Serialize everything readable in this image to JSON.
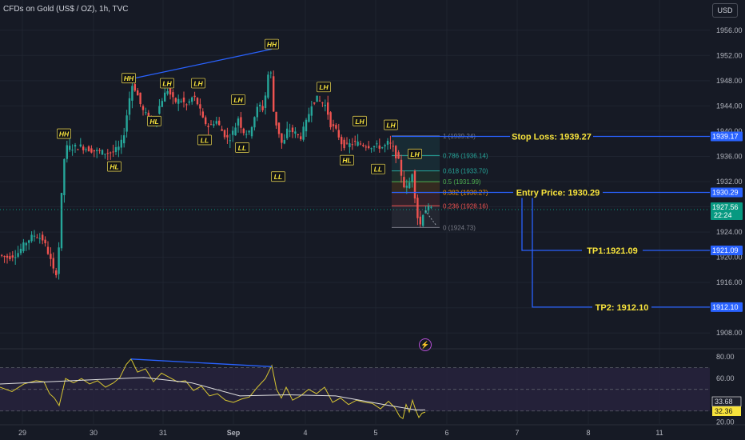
{
  "header": {
    "title": "CFDs on Gold (US$ / OZ), 1h, TVC",
    "currency": "USD"
  },
  "colors": {
    "background": "#161a25",
    "grid": "#1f2430",
    "axis_text": "#b2b5be",
    "up": "#26a69a",
    "down": "#ef5350",
    "trade_line": "#2962ff",
    "annotation_text": "#f7e33c",
    "rsi": "#d7c631",
    "rsi_ma": "#e0e0e0",
    "rsi_band": "#2a2440",
    "current_price_bg": "#089981"
  },
  "icons": [
    "lightning-icon"
  ],
  "chart_data": [
    {
      "type": "candlestick",
      "title": "CFDs on Gold (US$ / OZ), 1h, TVC",
      "ylim": [
        1906,
        1958
      ],
      "y_ticks": [
        1956,
        1952,
        1948,
        1944,
        1940,
        1936,
        1932,
        1928,
        1924,
        1920,
        1916,
        1912,
        1908
      ],
      "x_ticks": [
        "29",
        "30",
        "31",
        "Sep",
        "4",
        "5",
        "6",
        "7",
        "8",
        "11"
      ],
      "price_path": [
        {
          "x": 0,
          "y": 1920.4
        },
        {
          "x": 12,
          "y": 1920.0
        },
        {
          "x": 24,
          "y": 1920.6
        },
        {
          "x": 36,
          "y": 1922.6
        },
        {
          "x": 46,
          "y": 1923.6
        },
        {
          "x": 56,
          "y": 1922.8
        },
        {
          "x": 64,
          "y": 1920.2
        },
        {
          "x": 70,
          "y": 1917.4
        },
        {
          "x": 74,
          "y": 1917.8
        },
        {
          "x": 78,
          "y": 1926.4
        },
        {
          "x": 81,
          "y": 1934.8
        },
        {
          "x": 86,
          "y": 1937.4
        },
        {
          "x": 94,
          "y": 1937.4
        },
        {
          "x": 102,
          "y": 1937.6
        },
        {
          "x": 112,
          "y": 1937.2
        },
        {
          "x": 122,
          "y": 1936.8
        },
        {
          "x": 132,
          "y": 1936.6
        },
        {
          "x": 142,
          "y": 1936.6
        },
        {
          "x": 150,
          "y": 1937.2
        },
        {
          "x": 156,
          "y": 1938.6
        },
        {
          "x": 162,
          "y": 1943.6
        },
        {
          "x": 167,
          "y": 1947.4
        },
        {
          "x": 172,
          "y": 1946.6
        },
        {
          "x": 180,
          "y": 1943.4
        },
        {
          "x": 188,
          "y": 1942.0
        },
        {
          "x": 194,
          "y": 1941.4
        },
        {
          "x": 200,
          "y": 1943.4
        },
        {
          "x": 206,
          "y": 1945.4
        },
        {
          "x": 212,
          "y": 1946.6
        },
        {
          "x": 220,
          "y": 1944.6
        },
        {
          "x": 228,
          "y": 1945.0
        },
        {
          "x": 236,
          "y": 1944.0
        },
        {
          "x": 244,
          "y": 1945.6
        },
        {
          "x": 250,
          "y": 1944.2
        },
        {
          "x": 256,
          "y": 1941.8
        },
        {
          "x": 264,
          "y": 1940.6
        },
        {
          "x": 272,
          "y": 1941.8
        },
        {
          "x": 280,
          "y": 1940.0
        },
        {
          "x": 288,
          "y": 1938.6
        },
        {
          "x": 296,
          "y": 1940.4
        },
        {
          "x": 300,
          "y": 1942.2
        },
        {
          "x": 306,
          "y": 1940.0
        },
        {
          "x": 314,
          "y": 1939.6
        },
        {
          "x": 320,
          "y": 1942.2
        },
        {
          "x": 326,
          "y": 1944.2
        },
        {
          "x": 332,
          "y": 1943.4
        },
        {
          "x": 336,
          "y": 1947.6
        },
        {
          "x": 340,
          "y": 1951.0
        },
        {
          "x": 344,
          "y": 1943.4
        },
        {
          "x": 348,
          "y": 1941.0
        },
        {
          "x": 352,
          "y": 1939.4
        },
        {
          "x": 356,
          "y": 1937.4
        },
        {
          "x": 362,
          "y": 1940.4
        },
        {
          "x": 370,
          "y": 1939.8
        },
        {
          "x": 378,
          "y": 1939.0
        },
        {
          "x": 386,
          "y": 1941.6
        },
        {
          "x": 392,
          "y": 1944.4
        },
        {
          "x": 398,
          "y": 1945.2
        },
        {
          "x": 404,
          "y": 1944.6
        },
        {
          "x": 410,
          "y": 1944.0
        },
        {
          "x": 416,
          "y": 1941.0
        },
        {
          "x": 424,
          "y": 1939.8
        },
        {
          "x": 430,
          "y": 1938.0
        },
        {
          "x": 436,
          "y": 1937.6
        },
        {
          "x": 444,
          "y": 1938.2
        },
        {
          "x": 452,
          "y": 1938.0
        },
        {
          "x": 460,
          "y": 1937.8
        },
        {
          "x": 468,
          "y": 1937.6
        },
        {
          "x": 476,
          "y": 1937.6
        },
        {
          "x": 482,
          "y": 1937.4
        },
        {
          "x": 488,
          "y": 1938.2
        },
        {
          "x": 494,
          "y": 1937.2
        },
        {
          "x": 498,
          "y": 1936.0
        },
        {
          "x": 502,
          "y": 1934.8
        },
        {
          "x": 506,
          "y": 1931.8
        },
        {
          "x": 510,
          "y": 1930.8
        },
        {
          "x": 514,
          "y": 1931.6
        },
        {
          "x": 518,
          "y": 1933.6
        },
        {
          "x": 520,
          "y": 1931.2
        },
        {
          "x": 524,
          "y": 1926.6
        },
        {
          "x": 528,
          "y": 1925.2
        },
        {
          "x": 532,
          "y": 1927.4
        },
        {
          "x": 536,
          "y": 1927.8
        },
        {
          "x": 540,
          "y": 1927.6
        }
      ],
      "swing_labels": [
        {
          "text": "HH",
          "x": 80,
          "y": 1939.6,
          "placement": "above"
        },
        {
          "text": "HL",
          "x": 143,
          "y": 1934.4,
          "placement": "below"
        },
        {
          "text": "HH",
          "x": 161,
          "y": 1948.4,
          "placement": "above"
        },
        {
          "text": "HL",
          "x": 193,
          "y": 1941.6,
          "placement": "below"
        },
        {
          "text": "LH",
          "x": 209,
          "y": 1947.6,
          "placement": "above"
        },
        {
          "text": "LH",
          "x": 248,
          "y": 1947.6,
          "placement": "above"
        },
        {
          "text": "LL",
          "x": 256,
          "y": 1938.6,
          "placement": "below"
        },
        {
          "text": "LH",
          "x": 298,
          "y": 1945.0,
          "placement": "above"
        },
        {
          "text": "LL",
          "x": 303,
          "y": 1937.4,
          "placement": "below"
        },
        {
          "text": "HH",
          "x": 340,
          "y": 1953.8,
          "placement": "above"
        },
        {
          "text": "LL",
          "x": 348,
          "y": 1932.8,
          "placement": "below"
        },
        {
          "text": "LH",
          "x": 405,
          "y": 1947.0,
          "placement": "above"
        },
        {
          "text": "LH",
          "x": 450,
          "y": 1941.6,
          "placement": "above"
        },
        {
          "text": "HL",
          "x": 434,
          "y": 1935.4,
          "placement": "below"
        },
        {
          "text": "LL",
          "x": 473,
          "y": 1934.0,
          "placement": "below"
        },
        {
          "text": "LH",
          "x": 489,
          "y": 1941.0,
          "placement": "above"
        },
        {
          "text": "LH",
          "x": 519,
          "y": 1936.4,
          "placement": "above"
        }
      ],
      "trendline": {
        "from": {
          "x": 161,
          "y": 1948.2
        },
        "to": {
          "x": 340,
          "y": 1953.0
        }
      },
      "fibonacci": {
        "x_range": [
          490,
          550
        ],
        "levels": [
          {
            "label": "1 (1939.24)",
            "price": 1939.24,
            "color": "#787b86"
          },
          {
            "label": "0.786 (1936.14)",
            "price": 1936.14,
            "color": "#26a69a"
          },
          {
            "label": "0.618 (1933.70)",
            "price": 1933.7,
            "color": "#26a69a"
          },
          {
            "label": "0.5 (1931.99)",
            "price": 1931.99,
            "color": "#4caf50"
          },
          {
            "label": "0.382 (1930.27)",
            "price": 1930.27,
            "color": "#ff9800"
          },
          {
            "label": "0.236 (1928.16)",
            "price": 1928.16,
            "color": "#ef5350"
          },
          {
            "label": "0 (1924.73)",
            "price": 1924.73,
            "color": "#787b86"
          }
        ]
      },
      "trade_levels": [
        {
          "label": "Stop Loss: 1939.27",
          "price": 1939.17,
          "axis_label": "1939.17"
        },
        {
          "label": "Entry Price: 1930.29",
          "price": 1930.29,
          "axis_label": "1930.29"
        },
        {
          "label": "TP1:1921.09",
          "price": 1921.09,
          "axis_label": "1921.09"
        },
        {
          "label": "TP2: 1912.10",
          "price": 1912.1,
          "axis_label": "1912.10"
        }
      ],
      "current_price": {
        "value": "1927.56",
        "countdown": "22:24",
        "price": 1927.56
      }
    },
    {
      "type": "line",
      "title": "",
      "ylim": [
        18,
        86
      ],
      "y_ticks": [
        80.0,
        60.0,
        40.0,
        20.0
      ],
      "bands": [
        70,
        30
      ],
      "series": [
        {
          "role": "rsi",
          "x": [
            0,
            15,
            30,
            45,
            55,
            62,
            68,
            74,
            82,
            92,
            102,
            112,
            122,
            132,
            142,
            150,
            158,
            164,
            172,
            182,
            192,
            202,
            212,
            222,
            232,
            242,
            252,
            262,
            272,
            282,
            292,
            302,
            312,
            322,
            332,
            340,
            346,
            352,
            358,
            366,
            376,
            386,
            396,
            406,
            416,
            426,
            436,
            446,
            456,
            466,
            476,
            486,
            494,
            500,
            504,
            508,
            512,
            516,
            520,
            524,
            528,
            532
          ],
          "values": [
            52,
            48,
            55,
            58,
            57,
            46,
            42,
            35,
            60,
            56,
            60,
            55,
            58,
            52,
            56,
            61,
            73,
            78,
            66,
            69,
            57,
            65,
            61,
            57,
            58,
            49,
            53,
            44,
            46,
            40,
            38,
            41,
            43,
            52,
            60,
            72,
            50,
            42,
            52,
            40,
            44,
            50,
            46,
            52,
            38,
            42,
            36,
            40,
            38,
            37,
            32,
            39,
            33,
            25,
            23,
            36,
            29,
            40,
            31,
            24,
            28,
            29
          ]
        },
        {
          "role": "rsi_ma",
          "x": [
            0,
            60,
            120,
            180,
            240,
            300,
            360,
            420,
            480,
            520,
            532
          ],
          "values": [
            55,
            57,
            59,
            61,
            56,
            44,
            45,
            44,
            36,
            31,
            31
          ]
        }
      ],
      "divergence_line": {
        "from": {
          "x": 164,
          "y": 78
        },
        "to": {
          "x": 340,
          "y": 71
        }
      },
      "value_labels": [
        "33.68",
        "32.36"
      ]
    }
  ]
}
